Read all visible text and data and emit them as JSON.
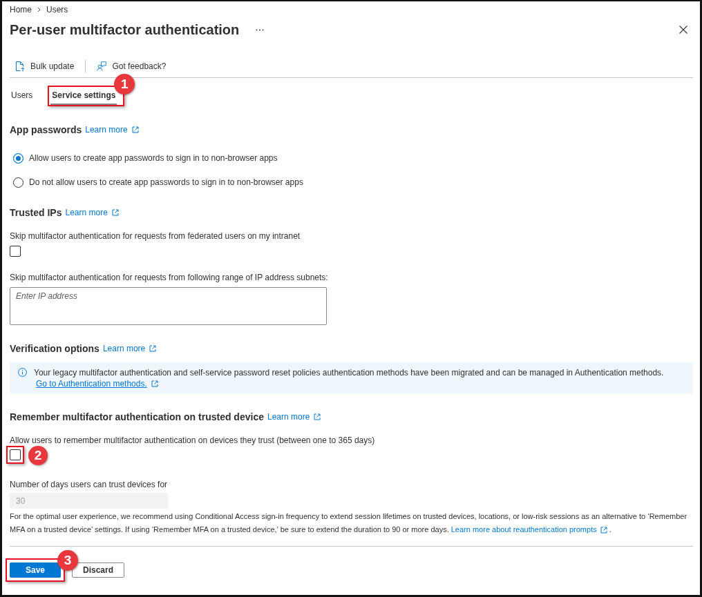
{
  "breadcrumb": [
    {
      "label": "Home"
    },
    {
      "label": "Users"
    }
  ],
  "title": "Per-user multifactor authentication",
  "toolbar": [
    {
      "kind": "bulk_update",
      "label": "Bulk update"
    },
    {
      "kind": "feedback",
      "label": "Got feedback?"
    }
  ],
  "tabs": [
    {
      "label": "Users",
      "selected": false
    },
    {
      "label": "Service settings",
      "selected": true,
      "callout": "1"
    }
  ],
  "sections": [
    {
      "heading": "App passwords",
      "link": "Learn more",
      "items": [
        {
          "kind": "radio",
          "label": "Allow users to create app passwords to sign in to non-browser apps",
          "selected": true
        },
        {
          "kind": "radio",
          "label": "Do not allow users to create app passwords to sign in to non-browser apps",
          "selected": false
        }
      ]
    },
    {
      "heading": "Trusted IPs",
      "link": "Learn more",
      "items": [
        {
          "kind": "checkbox",
          "label": "Skip multifactor authentication for requests from federated users on my intranet",
          "checked": false
        },
        {
          "kind": "textarea",
          "label": "Skip multifactor authentication for requests from following range of IP address subnets:",
          "placeholder": "Enter IP address"
        }
      ]
    },
    {
      "heading": "Verification options",
      "link": "Learn more",
      "items": [
        {
          "kind": "info",
          "text": "Your legacy multifactor authentication and self-service password reset policies authentication methods have been migrated and can be managed in Authentication methods.",
          "link": "Go to Authentication methods."
        }
      ]
    },
    {
      "heading": "Remember multifactor authentication on trusted device",
      "link": "Learn more",
      "items": [
        {
          "kind": "checkbox",
          "label": "Allow users to remember multifactor authentication on devices they trust (between one to 365 days)",
          "checked": false,
          "callout": "2"
        },
        {
          "kind": "number",
          "label": "Number of days users can trust devices for",
          "value": "30",
          "disabled": true
        },
        {
          "kind": "note",
          "text": "For the optimal user experience, we recommend using Conditional Access sign-in frequency to extend session lifetimes on trusted devices, locations, or low-risk sessions as an alternative to ‘Remember MFA on a trusted device’ settings. If using ‘Remember MFA on a trusted device,’ be sure to extend the duration to 90 or more days.",
          "link": "Learn more about reauthentication prompts",
          "tail": "."
        }
      ]
    }
  ],
  "actions": [
    {
      "kind": "save",
      "label": "Save",
      "callout": "3"
    },
    {
      "kind": "discard",
      "label": "Discard"
    }
  ]
}
